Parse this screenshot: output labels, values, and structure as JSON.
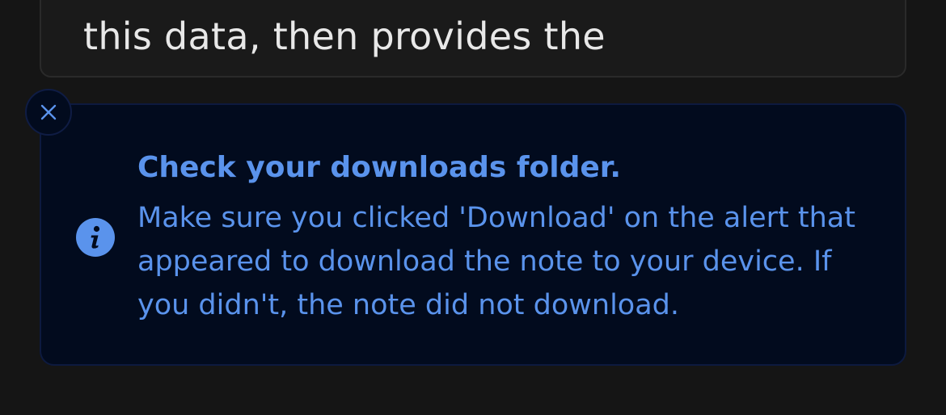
{
  "background_card": {
    "visible_text": "this data, then provides the"
  },
  "toast": {
    "close_icon": "close-icon",
    "status_icon": "info-icon",
    "title": "Check your downloads folder.",
    "message": "Make sure you clicked 'Download' on the alert that appeared to download the note to your device. If you didn't, the note did not download.",
    "accent_color": "#5a93ec",
    "background_color": "#020b1e"
  }
}
